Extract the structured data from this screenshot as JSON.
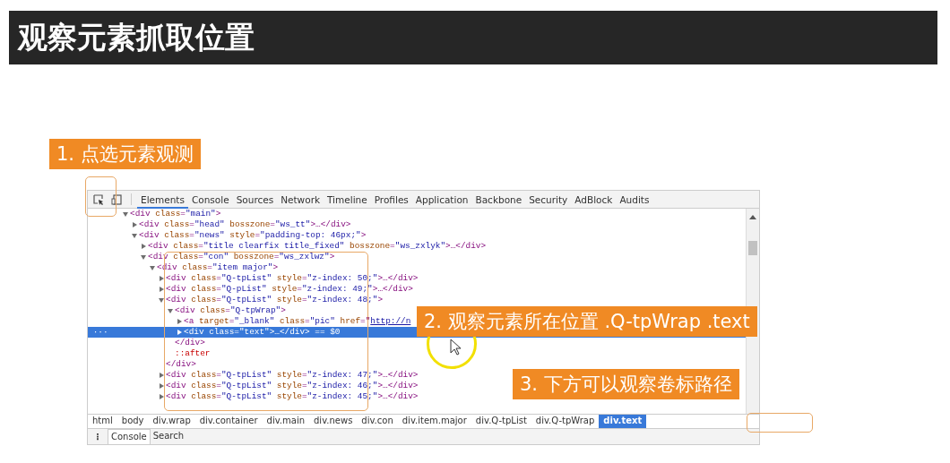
{
  "title": "观察元素抓取位置",
  "callouts": [
    {
      "text": "1. 点选元素观测"
    },
    {
      "text": "2. 观察元素所在位置 .Q-tpWrap .text"
    },
    {
      "text": "3. 下方可以观察卷标路径"
    }
  ],
  "devtools": {
    "tabs": [
      {
        "label": "Elements",
        "selected": true
      },
      {
        "label": "Console",
        "selected": false
      },
      {
        "label": "Sources",
        "selected": false
      },
      {
        "label": "Network",
        "selected": false
      },
      {
        "label": "Timeline",
        "selected": false
      },
      {
        "label": "Profiles",
        "selected": false
      },
      {
        "label": "Application",
        "selected": false
      },
      {
        "label": "Backbone",
        "selected": false
      },
      {
        "label": "Security",
        "selected": false
      },
      {
        "label": "AdBlock",
        "selected": false
      },
      {
        "label": "Audits",
        "selected": false
      }
    ],
    "dom_tree": [
      {
        "text": "<div class=\"main\">",
        "expanded": true,
        "selected": false,
        "children": [
          {
            "text": "<div class=\"head\" bosszone=\"ws_tt\">…</div>",
            "expanded": false,
            "selected": false
          },
          {
            "text": "<div class=\"news\" style=\"padding-top: 46px;\">",
            "expanded": true,
            "selected": false,
            "children": [
              {
                "text": "<div class=\"title clearfix title_fixed\" bosszone=\"ws_zxlyk\">…</div>",
                "expanded": false,
                "selected": false
              },
              {
                "text": "<div class=\"con\" bosszone=\"ws_zxlwz\">",
                "expanded": true,
                "selected": false,
                "children": [
                  {
                    "text": "<div class=\"item major\">",
                    "expanded": true,
                    "selected": false,
                    "children": [
                      {
                        "text": "<div class=\"Q-tpList\" style=\"z-index: 50;\">…</div>",
                        "expanded": false,
                        "selected": false
                      },
                      {
                        "text": "<div class=\"Q-pList\" style=\"z-index: 49;\">…</div>",
                        "expanded": false,
                        "selected": false
                      },
                      {
                        "text": "<div class=\"Q-tpList\" style=\"z-index: 48;\">",
                        "expanded": true,
                        "selected": false,
                        "closing": "</div>",
                        "children": [
                          {
                            "text": "<div class=\"Q-tpWrap\">",
                            "expanded": true,
                            "selected": false,
                            "closing": "</div>",
                            "children": [
                              {
                                "text": "<a target=\"_blank\" class=\"pic\" href=\"http://n",
                                "expanded": false,
                                "selected": false
                              },
                              {
                                "text": "<div class=\"text\">…</div> == $0",
                                "expanded": false,
                                "selected": true
                              }
                            ]
                          },
                          {
                            "text": "::after",
                            "selected": false
                          }
                        ]
                      },
                      {
                        "text": "<div class=\"Q-tpList\" style=\"z-index: 47;\">…</div>",
                        "expanded": false,
                        "selected": false
                      },
                      {
                        "text": "<div class=\"Q-tpList\" style=\"z-index: 46;\">…</div>",
                        "expanded": false,
                        "selected": false
                      },
                      {
                        "text": "<div class=\"Q-tpList\" style=\"z-index: 45;\">…</div>",
                        "expanded": false,
                        "selected": false
                      }
                    ]
                  }
                ]
              }
            ]
          }
        ]
      }
    ],
    "selected_row_marker": "···",
    "breadcrumbs": [
      {
        "label": "html",
        "selected": false
      },
      {
        "label": "body",
        "selected": false
      },
      {
        "label": "div.wrap",
        "selected": false
      },
      {
        "label": "div.container",
        "selected": false
      },
      {
        "label": "div.main",
        "selected": false
      },
      {
        "label": "div.news",
        "selected": false
      },
      {
        "label": "div.con",
        "selected": false
      },
      {
        "label": "div.item.major",
        "selected": false
      },
      {
        "label": "div.Q-tpList",
        "selected": false
      },
      {
        "label": "div.Q-tpWrap",
        "selected": false
      },
      {
        "label": "div.text",
        "selected": true
      }
    ],
    "drawer_menu": "⋮",
    "drawer_tabs": [
      {
        "label": "Console",
        "selected": true
      },
      {
        "label": "Search",
        "selected": false
      }
    ]
  }
}
